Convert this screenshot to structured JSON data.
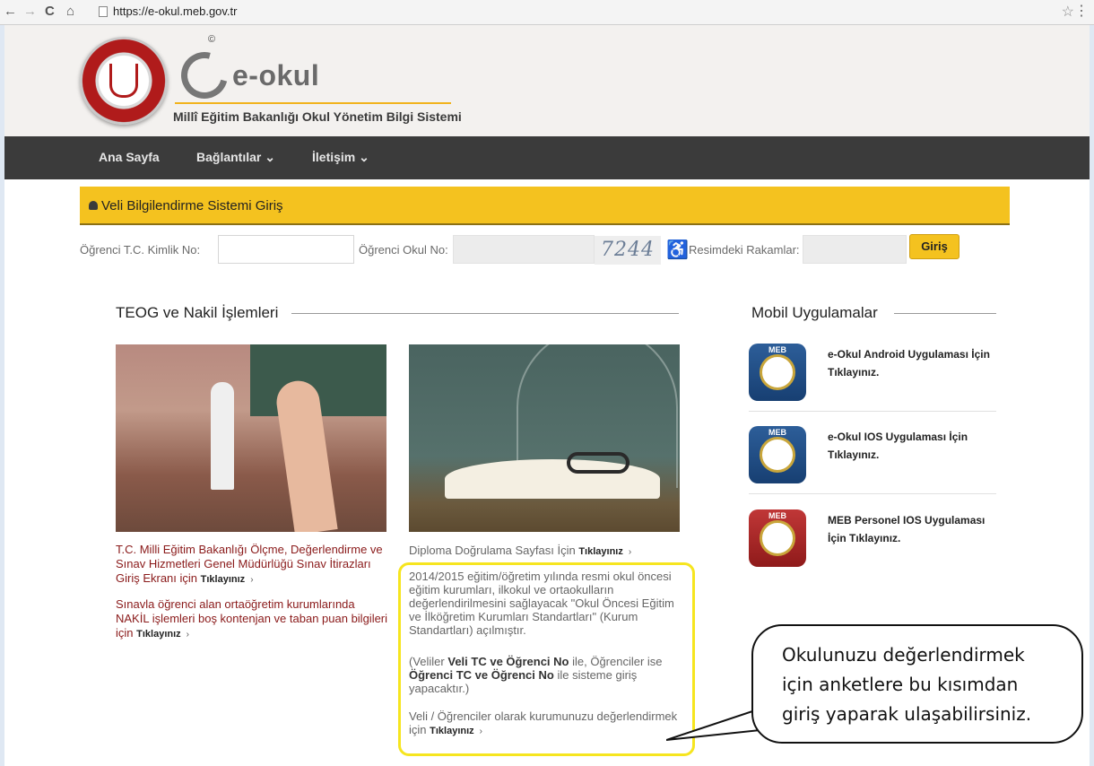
{
  "browser": {
    "url": "https://e-okul.meb.gov.tr"
  },
  "header": {
    "copyright": "©",
    "logo_title": "e-okul",
    "subtitle": "Millî Eğitim Bakanlığı Okul Yönetim Bilgi Sistemi"
  },
  "nav": {
    "items": [
      "Ana Sayfa",
      "Bağlantılar ⌄",
      "İletişim ⌄"
    ]
  },
  "login": {
    "title": "Veli Bilgilendirme Sistemi Giriş",
    "tc_label": "Öğrenci T.C. Kimlik No:",
    "tc_value": "",
    "school_label": "Öğrenci Okul No:",
    "captcha_text": "7244",
    "captcha_label": "Resimdeki Rakamlar:",
    "submit_label": "Giriş"
  },
  "teog": {
    "title": "TEOG ve Nakil İşlemleri",
    "link1_text": "T.C. Milli Eğitim Bakanlığı Ölçme, Değerlendirme ve Sınav Hizmetleri Genel Müdürlüğü Sınav İtirazları Giriş Ekranı için",
    "link2_text": "Sınavla öğrenci alan ortaöğretim kurumlarında NAKİL işlemleri boş kontenjan ve taban puan bilgileri için",
    "cta": "Tıklayınız",
    "arrow": "›"
  },
  "middle": {
    "diploma_text": "Diploma Doğrulama Sayfası İçin",
    "para1": "2014/2015 eğitim/öğretim yılında resmi okul öncesi eğitim kurumları, ilkokul ve ortaokulların değerlendirilmesini sağlayacak \"Okul Öncesi Eğitim ve İlköğretim Kurumları Standartları\" (Kurum Standartları) açılmıştır.",
    "para2_a": "(Veliler",
    "para2_b": "Veli TC ve Öğrenci No",
    "para2_c": "ile, Öğrenciler ise",
    "para2_d": "Öğrenci TC ve Öğrenci No",
    "para2_e": "ile sisteme giriş yapacaktır.)",
    "para3": "Veli / Öğrenciler olarak kurumunuzu değerlendirmek için"
  },
  "mobile": {
    "title": "Mobil Uygulamalar",
    "apps": [
      {
        "label": "e-Okul Android Uygulaması İçin Tıklayınız.",
        "badge": "MEB",
        "color": "#1f4a82"
      },
      {
        "label": "e-Okul IOS Uygulaması İçin Tıklayınız.",
        "badge": "MEB",
        "color": "#1f4a82"
      },
      {
        "label": "MEB Personel IOS Uygulaması İçin Tıklayınız.",
        "badge": "MEB",
        "color": "#a52323"
      }
    ]
  },
  "callout": {
    "line1": "Okulunuzu değerlendirmek",
    "line2": "için anketlere bu kısımdan",
    "line3": "giriş yaparak ulaşabilirsiniz."
  },
  "colors": {
    "accent": "#f4c21f",
    "nav_bg": "#3b3b3b",
    "link_red": "#8a1a1a",
    "highlight": "#f6e51f"
  }
}
